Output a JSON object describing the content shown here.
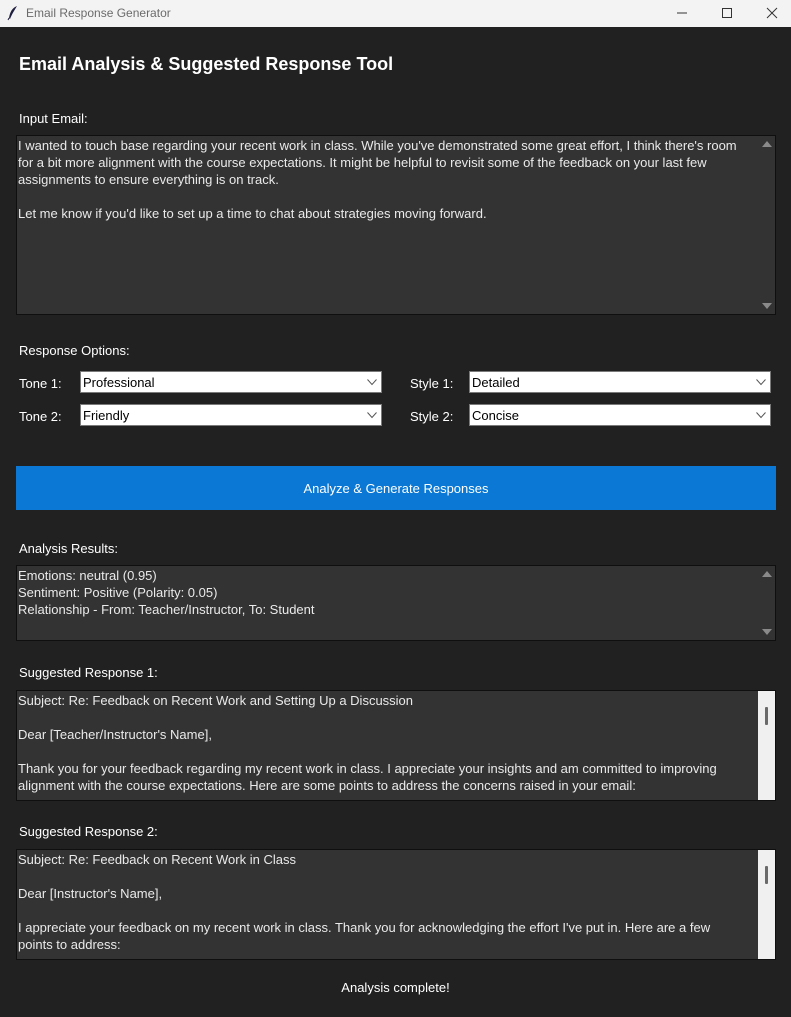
{
  "window": {
    "title": "Email Response Generator"
  },
  "heading": "Email Analysis & Suggested Response Tool",
  "input": {
    "label": "Input Email:",
    "text": "I wanted to touch base regarding your recent work in class. While you've demonstrated some great effort, I think there's room\nfor a bit more alignment with the course expectations. It might be helpful to revisit some of the feedback on your last few\nassignments to ensure everything is on track.\n\nLet me know if you'd like to set up a time to chat about strategies moving forward."
  },
  "options": {
    "label": "Response Options:",
    "tone1_label": "Tone 1:",
    "tone1_value": "Professional",
    "tone2_label": "Tone 2:",
    "tone2_value": "Friendly",
    "style1_label": "Style 1:",
    "style1_value": "Detailed",
    "style2_label": "Style 2:",
    "style2_value": "Concise"
  },
  "analyze_button": "Analyze & Generate Responses",
  "analysis": {
    "label": "Analysis Results:",
    "text": "Emotions: neutral (0.95)\nSentiment: Positive (Polarity: 0.05)\nRelationship - From: Teacher/Instructor, To: Student"
  },
  "response1": {
    "label": "Suggested Response 1:",
    "text": "Subject: Re: Feedback on Recent Work and Setting Up a Discussion\n\nDear [Teacher/Instructor's Name],\n\nThank you for your feedback regarding my recent work in class. I appreciate your insights and am committed to improving\nalignment with the course expectations. Here are some points to address the concerns raised in your email:"
  },
  "response2": {
    "label": "Suggested Response 2:",
    "text": "Subject: Re: Feedback on Recent Work in Class\n\nDear [Instructor's Name],\n\nI appreciate your feedback on my recent work in class. Thank you for acknowledging the effort I've put in. Here are a few\npoints to address:"
  },
  "status": "Analysis complete!",
  "icons": {
    "app": "feather-icon",
    "minimize": "minimize-icon",
    "maximize": "maximize-icon",
    "close": "close-icon"
  },
  "colors": {
    "background": "#212121",
    "accent": "#0a78d4",
    "field": "#333333"
  }
}
